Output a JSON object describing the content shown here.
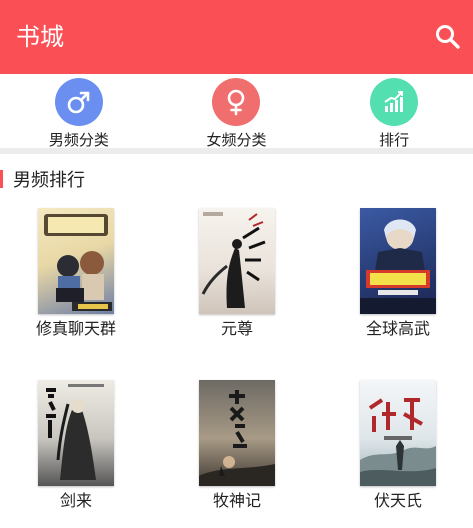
{
  "header": {
    "title": "书城",
    "bg_color": "#fa4f55"
  },
  "categories": [
    {
      "label": "男频分类",
      "icon": "male-icon",
      "color": "#6a8ff0"
    },
    {
      "label": "女频分类",
      "icon": "female-icon",
      "color": "#f16e6e"
    },
    {
      "label": "排行",
      "icon": "chart-icon",
      "color": "#53dfb0"
    }
  ],
  "section": {
    "title": "男频排行",
    "accent": "#fa4f55"
  },
  "books": [
    {
      "title": "修真聊天群"
    },
    {
      "title": "元尊"
    },
    {
      "title": "全球高武"
    },
    {
      "title": "剑来"
    },
    {
      "title": "牧神记"
    },
    {
      "title": "伏天氏"
    }
  ]
}
